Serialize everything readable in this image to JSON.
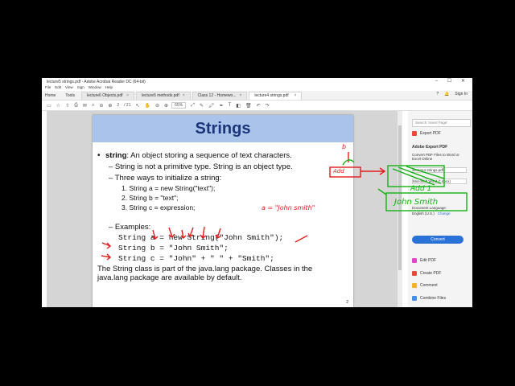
{
  "window": {
    "title": "lecture5 strings.pdf - Adobe Acrobat Reader DC (64-bit)",
    "controls": "–  ☐  ✕"
  },
  "menu": [
    "File",
    "Edit",
    "View",
    "Sign",
    "Window",
    "Help"
  ],
  "nav_tabs": [
    "Home",
    "Tools"
  ],
  "doc_tabs": [
    {
      "label": "lecture6 Objects.pdf",
      "active": false
    },
    {
      "label": "lecture5 methods.pdf",
      "active": false
    },
    {
      "label": "Class 12 - Homewo...",
      "active": false
    },
    {
      "label": "lecture4 strings.pdf",
      "active": true
    }
  ],
  "account": {
    "sign_in": "Sign In"
  },
  "toolbar": {
    "page_current": "2",
    "page_total": "/ 21",
    "zoom": "65%"
  },
  "slide": {
    "title": "Strings",
    "bullet_term": "string",
    "bullet_rest": ": An object storing a sequence of text characters.",
    "sub1": "– String is not a primitive type. String is an object type.",
    "sub2": "– Three ways to initialize a string:",
    "ways": [
      "1.    String a = new String(\"text\");",
      "2.    String b = \"text\";",
      "3.    String c = expression;"
    ],
    "examples_label": "– Examples:",
    "code": [
      "String a = new String(\"John Smith\");",
      "String b = \"John Smith\";",
      "String c = \"John\" + \" \" + \"Smith\";"
    ],
    "footer": "The String class is part of the java.lang package. Classes in the java.lang package are available by default.",
    "page_number": "2"
  },
  "right_pane": {
    "search_placeholder": "Search 'Insert Page'",
    "export_pdf": "Export PDF",
    "adobe_export": "Adobe Export PDF",
    "convert_desc": "Convert PDF Files to Word or Excel Online",
    "select_file": "lecture4 strings.pdf",
    "convert_to": "Microsoft Word (*.docx)",
    "doc_language_label": "Document Language:",
    "doc_language_value": "English (U.S.)",
    "change": "Change",
    "convert_button": "Convert",
    "tools": [
      "Edit PDF",
      "Create PDF",
      "Comment",
      "Combine Files"
    ]
  },
  "annotations": {
    "a_note": "a = \"John smith\"",
    "b_label": "b",
    "add_label": "Add",
    "addr1": "Add 1",
    "john_smith": "John Smith",
    "colors": {
      "red": "#e41b1b",
      "green": "#12b312"
    }
  }
}
